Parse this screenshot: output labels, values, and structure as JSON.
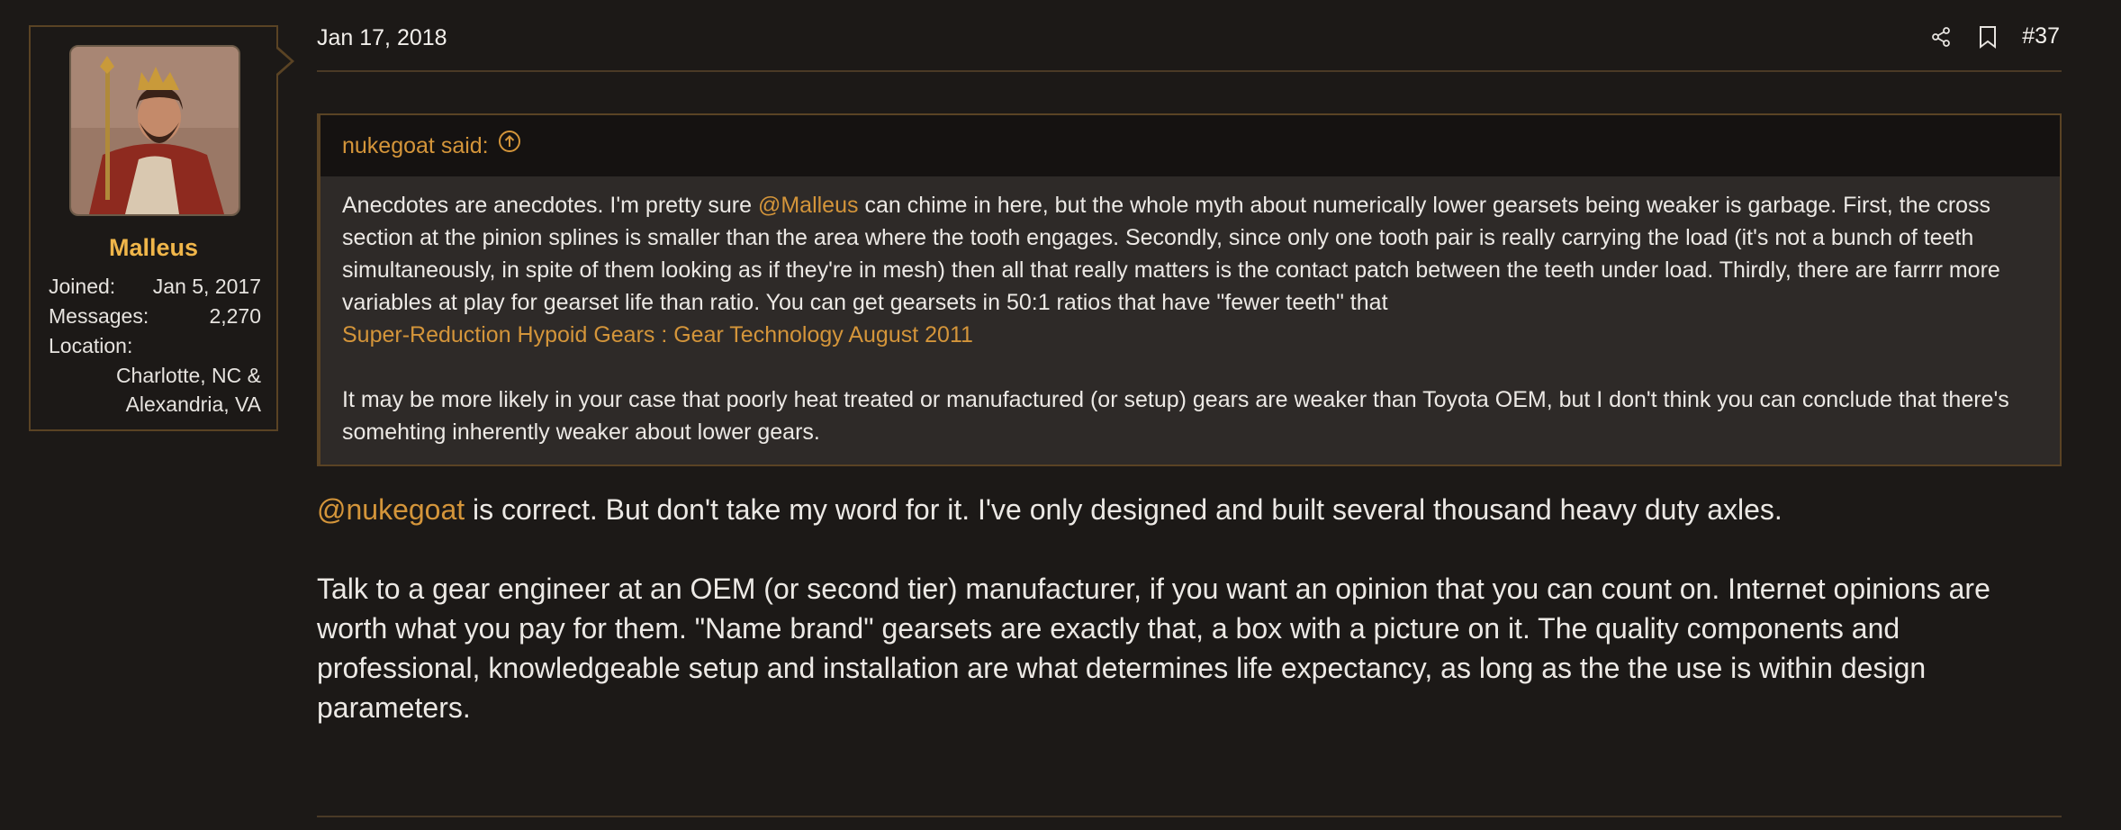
{
  "post": {
    "date": "Jan 17, 2018",
    "number": "#37",
    "icons": {
      "share": "share-icon",
      "bookmark": "bookmark-icon"
    }
  },
  "user": {
    "name": "Malleus",
    "avatar": "avatar-king-portrait",
    "joined_label": "Joined:",
    "joined_value": "Jan 5, 2017",
    "messages_label": "Messages:",
    "messages_value": "2,270",
    "location_label": "Location:",
    "location_line1": "Charlotte, NC &",
    "location_line2": "Alexandria, VA"
  },
  "quote": {
    "author_said": "nukegoat said:",
    "icon": "arrow-up-circle-icon",
    "p1_a": "Anecdotes are anecdotes. I'm pretty sure ",
    "p1_mention": "@Malleus",
    "p1_b": " can chime in here, but the whole myth about numerically lower gearsets being weaker is garbage. First, the cross section at the pinion splines is smaller than the area where the tooth engages. Secondly, since only one tooth pair is really carrying the load (it's not a bunch of teeth simultaneously, in spite of them looking as if they're in mesh) then all that really matters is the contact patch between the teeth under load. Thirdly, there are farrrr more variables at play for gearset life than ratio. You can get gearsets in 50:1 ratios that have \"fewer teeth\" that",
    "link": "Super-Reduction Hypoid Gears : Gear Technology August 2011",
    "p2": "It may be more likely in your case that poorly heat treated or manufactured (or setup) gears are weaker than Toyota OEM, but I don't think you can conclude that there's somehting inherently weaker about lower gears."
  },
  "reply": {
    "mention": "@nukegoat",
    "p1": " is correct. But don't take my word for it. I've only designed and built several thousand heavy duty axles.",
    "p2": "Talk to a gear engineer at an OEM (or second tier) manufacturer, if you want an opinion that you can count on. Internet opinions are worth what you pay for them. \"Name brand\" gearsets are exactly that, a box with a picture on it. The quality components and professional, knowledgeable setup and installation are what determines life expectancy, as long as the the use is within design parameters."
  },
  "colors": {
    "background": "#1c1917",
    "accent": "#d4953a",
    "username": "#f0b64a",
    "border": "#5a4324",
    "quote_bg": "#2e2a28"
  }
}
